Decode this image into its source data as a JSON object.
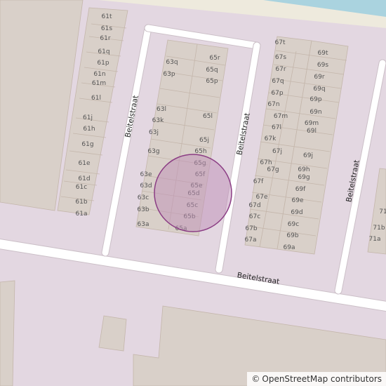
{
  "map": {
    "colors": {
      "residential": "#e3d7e1",
      "building": "#d9d0c9",
      "building_stroke": "#c4b6ab",
      "road": "#ffffff",
      "road_casing": "#cbbfc7",
      "water": "#aad3df",
      "beach": "#eeeadd",
      "marker_fill": "#bf8fb8",
      "marker_stroke": "#8b3d84"
    },
    "streets": [
      {
        "id": "street-beitelstraat-south",
        "name": "Beitelstraat"
      },
      {
        "id": "street-beitelstraat-west",
        "name": "Beitelstraat"
      },
      {
        "id": "street-beitelstraat-middle",
        "name": "Beitelstraat"
      },
      {
        "id": "street-beitelstraat-east",
        "name": "Beitelstraat"
      }
    ],
    "house_numbers": [
      "61t",
      "61s",
      "61r",
      "61q",
      "61p",
      "61n",
      "61m",
      "61l",
      "61j",
      "61h",
      "61g",
      "61e",
      "61d",
      "61c",
      "61b",
      "61a",
      "63q",
      "63p",
      "63l",
      "63k",
      "63j",
      "63g",
      "63e",
      "63d",
      "63c",
      "63b",
      "63a",
      "65r",
      "65q",
      "65p",
      "65l",
      "65j",
      "65h",
      "65g",
      "65f",
      "65e",
      "65d",
      "65c",
      "65b",
      "65a",
      "67t",
      "67s",
      "67r",
      "67q",
      "67p",
      "67n",
      "67m",
      "67l",
      "67k",
      "67j",
      "67h",
      "67g",
      "67f",
      "67e",
      "67d",
      "67c",
      "67b",
      "67a",
      "69t",
      "69s",
      "69r",
      "69q",
      "69p",
      "69n",
      "69m",
      "69l",
      "69j",
      "69h",
      "69g",
      "69f",
      "69e",
      "69d",
      "69c",
      "69b",
      "69a",
      "71b",
      "71a",
      "71"
    ],
    "attribution": {
      "symbol": "©",
      "text": "OpenStreetMap contributors"
    }
  }
}
